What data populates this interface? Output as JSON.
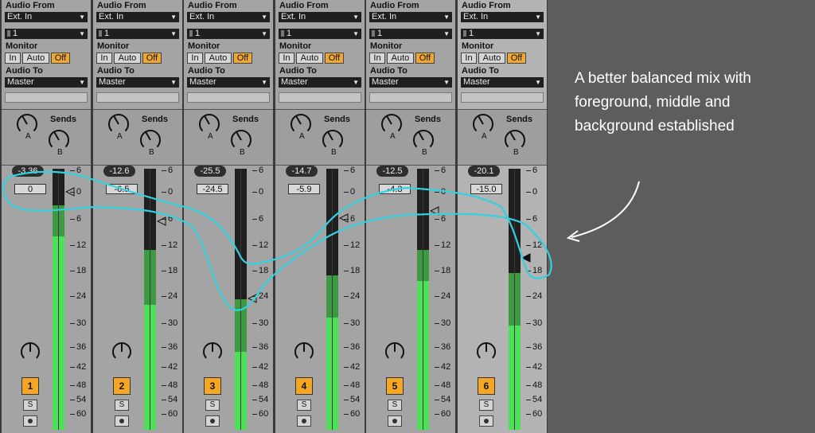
{
  "labels": {
    "audio_from": "Audio From",
    "monitor": "Monitor",
    "audio_to": "Audio To",
    "sends": "Sends",
    "send_a": "A",
    "send_b": "B",
    "mon_in": "In",
    "mon_auto": "Auto",
    "mon_off": "Off",
    "solo": "S"
  },
  "scale": [
    "6",
    "0",
    "6",
    "12",
    "18",
    "24",
    "30",
    "36",
    "42",
    "48",
    "54",
    "60"
  ],
  "tracks": [
    {
      "number": "1",
      "input_type": "Ext. In",
      "channel": "1",
      "output": "Master",
      "monitor": "Off",
      "peak": "-3.36",
      "volume": "0",
      "fader_db": 0,
      "meter_level": 0.74,
      "peak_level": 0.86,
      "selected": false
    },
    {
      "number": "2",
      "input_type": "Ext. In",
      "channel": "1",
      "output": "Master",
      "monitor": "Off",
      "peak": "-12.6",
      "volume": "-6.5",
      "fader_db": -6.5,
      "meter_level": 0.48,
      "peak_level": 0.69,
      "selected": false
    },
    {
      "number": "3",
      "input_type": "Ext. In",
      "channel": "1",
      "output": "Master",
      "monitor": "Off",
      "peak": "-25.5",
      "volume": "-24.5",
      "fader_db": -24.5,
      "meter_level": 0.3,
      "peak_level": 0.5,
      "selected": false
    },
    {
      "number": "4",
      "input_type": "Ext. In",
      "channel": "1",
      "output": "Master",
      "monitor": "Off",
      "peak": "-14.7",
      "volume": "-5.9",
      "fader_db": -5.9,
      "meter_level": 0.43,
      "peak_level": 0.59,
      "selected": false
    },
    {
      "number": "5",
      "input_type": "Ext. In",
      "channel": "1",
      "output": "Master",
      "monitor": "Off",
      "peak": "-12.5",
      "volume": "-4.3",
      "fader_db": -4.3,
      "meter_level": 0.57,
      "peak_level": 0.69,
      "selected": false
    },
    {
      "number": "6",
      "input_type": "Ext. In",
      "channel": "1",
      "output": "Master",
      "monitor": "Off",
      "peak": "-20.1",
      "volume": "-15.0",
      "fader_db": -15.0,
      "meter_level": 0.4,
      "peak_level": 0.6,
      "selected": true
    }
  ],
  "caption": "A better balanced mix with foreground, middle and background established",
  "colors": {
    "meter_green": "#4fe05a",
    "meter_dark_green": "#3e9a42",
    "monitor_on": "#f0a830",
    "track_number": "#f5a623",
    "annotation": "#33d1e0",
    "arrow": "#ffffff"
  }
}
